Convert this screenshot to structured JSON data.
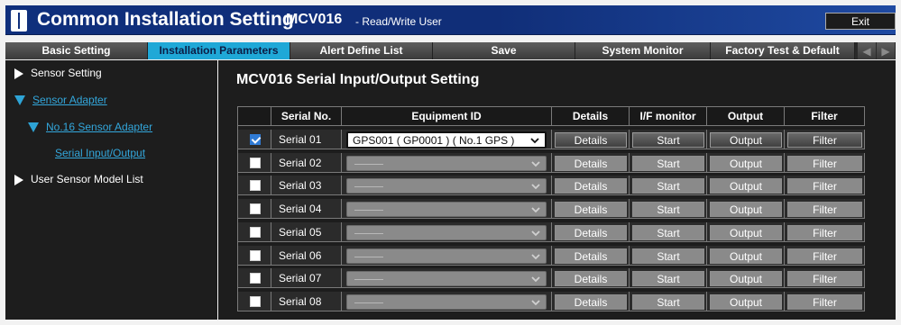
{
  "titlebar": {
    "app_title": "Common Installation Setting",
    "model": "MCV016",
    "role": "- Read/Write User",
    "exit_label": "Exit"
  },
  "menu": {
    "tabs": [
      {
        "label": "Basic Setting",
        "active": false
      },
      {
        "label": "Installation Parameters",
        "active": true
      },
      {
        "label": "Alert Define List",
        "active": false
      },
      {
        "label": "Save",
        "active": false
      },
      {
        "label": "System Monitor",
        "active": false
      },
      {
        "label": "Factory Test & Default",
        "active": false
      }
    ],
    "prev_icon": "triangle-left-icon",
    "next_icon": "triangle-right-icon"
  },
  "sidebar": {
    "items": [
      {
        "label": "Sensor Setting",
        "icon": "triangle-right-icon"
      },
      {
        "label": "Sensor Adapter",
        "icon": "triangle-down-icon"
      },
      {
        "label": "No.16 Sensor Adapter",
        "icon": "triangle-down-icon"
      },
      {
        "label": "Serial Input/Output"
      },
      {
        "label": "User Sensor Model List",
        "icon": "triangle-right-icon"
      }
    ]
  },
  "main": {
    "title": "MCV016 Serial Input/Output Setting",
    "headers": [
      "",
      "Serial No.",
      "Equipment ID",
      "Details",
      "I/F monitor",
      "Output",
      "Filter"
    ],
    "rows": [
      {
        "checked": true,
        "serial": "Serial 01",
        "equipment": "GPS001 ( GP0001 ) ( No.1 GPS )",
        "enabled": true,
        "details": "Details",
        "monitor": "Start",
        "output": "Output",
        "filter": "Filter"
      },
      {
        "checked": false,
        "serial": "Serial 02",
        "equipment": "",
        "enabled": false,
        "details": "Details",
        "monitor": "Start",
        "output": "Output",
        "filter": "Filter"
      },
      {
        "checked": false,
        "serial": "Serial 03",
        "equipment": "",
        "enabled": false,
        "details": "Details",
        "monitor": "Start",
        "output": "Output",
        "filter": "Filter"
      },
      {
        "checked": false,
        "serial": "Serial 04",
        "equipment": "",
        "enabled": false,
        "details": "Details",
        "monitor": "Start",
        "output": "Output",
        "filter": "Filter"
      },
      {
        "checked": false,
        "serial": "Serial 05",
        "equipment": "",
        "enabled": false,
        "details": "Details",
        "monitor": "Start",
        "output": "Output",
        "filter": "Filter"
      },
      {
        "checked": false,
        "serial": "Serial 06",
        "equipment": "",
        "enabled": false,
        "details": "Details",
        "monitor": "Start",
        "output": "Output",
        "filter": "Filter"
      },
      {
        "checked": false,
        "serial": "Serial 07",
        "equipment": "",
        "enabled": false,
        "details": "Details",
        "monitor": "Start",
        "output": "Output",
        "filter": "Filter"
      },
      {
        "checked": false,
        "serial": "Serial 08",
        "equipment": "",
        "enabled": false,
        "details": "Details",
        "monitor": "Start",
        "output": "Output",
        "filter": "Filter"
      }
    ]
  },
  "colors": {
    "titlebar": "#0f2f7c",
    "active_tab": "#1fa8d7",
    "link": "#33a7dc",
    "panel": "#1d1d1d"
  }
}
